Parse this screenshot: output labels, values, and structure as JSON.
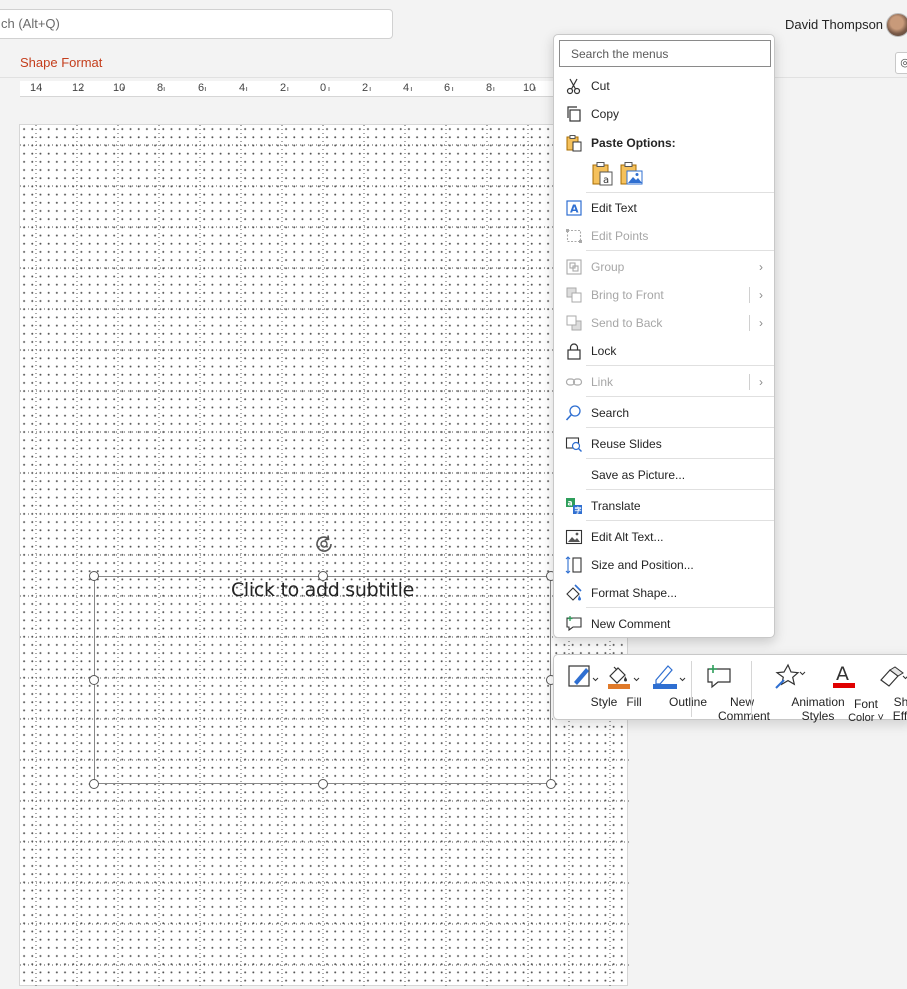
{
  "topbar": {
    "search_text": "ch (Alt+Q)",
    "username": "David Thompson"
  },
  "ribbon": {
    "tab_label": "Shape Format"
  },
  "ruler": {
    "labels": [
      "14",
      "12",
      "10",
      "8",
      "6",
      "4",
      "2",
      "0",
      "2",
      "4",
      "6",
      "8",
      "10"
    ]
  },
  "slide": {
    "subtitle_placeholder": "Click to add subtitle"
  },
  "context_menu": {
    "search_placeholder": "Search the menus",
    "cut": "Cut",
    "copy": "Copy",
    "paste_options": "Paste Options:",
    "edit_text": "Edit Text",
    "edit_points": "Edit Points",
    "group": "Group",
    "bring_to_front": "Bring to Front",
    "send_to_back": "Send to Back",
    "lock": "Lock",
    "link": "Link",
    "search": "Search",
    "reuse_slides": "Reuse Slides",
    "save_as_picture": "Save as Picture...",
    "translate": "Translate",
    "edit_alt_text": "Edit Alt Text...",
    "size_and_position": "Size and Position...",
    "format_shape": "Format Shape...",
    "new_comment": "New Comment"
  },
  "mini_toolbar": {
    "style": "Style",
    "fill": "Fill",
    "outline": "Outline",
    "new_comment_1": "New",
    "new_comment_2": "Comment",
    "animation_styles_1": "Animation",
    "animation_styles_2": "Styles",
    "font_color_1": "Font",
    "font_color_2": "Color ˅",
    "shape_effects_1": "Shape",
    "shape_effects_2": "Effects"
  },
  "colors": {
    "accent_tab": "#c43e1c",
    "fill_orange": "#e07a2a",
    "outline_blue": "#2f6fd1",
    "font_red": "#e00000"
  }
}
